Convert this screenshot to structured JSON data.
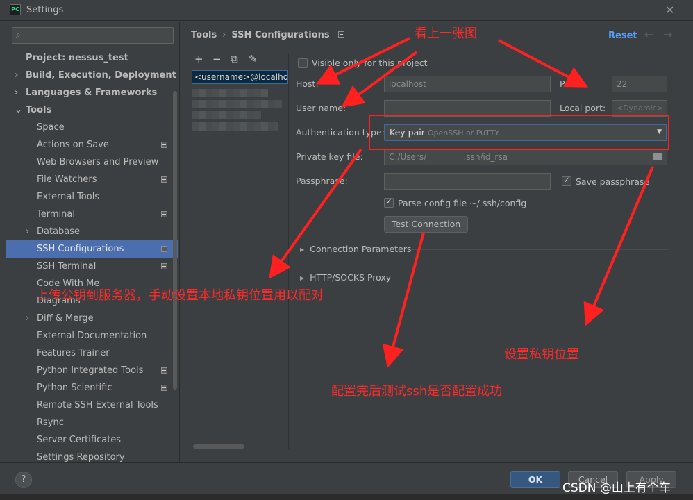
{
  "window": {
    "title": "Settings",
    "app_logo": "PC"
  },
  "sidebar": {
    "items": [
      {
        "label": "Project: nessus_test",
        "bold": true,
        "arrow": "",
        "indent": 0,
        "badge": false
      },
      {
        "label": "Build, Execution, Deployment",
        "bold": true,
        "arrow": "›",
        "indent": 0,
        "badge": false
      },
      {
        "label": "Languages & Frameworks",
        "bold": true,
        "arrow": "›",
        "indent": 0,
        "badge": false
      },
      {
        "label": "Tools",
        "bold": true,
        "arrow": "⌄",
        "indent": 0,
        "badge": false
      },
      {
        "label": "Space",
        "bold": false,
        "arrow": "",
        "indent": 1,
        "badge": false
      },
      {
        "label": "Actions on Save",
        "bold": false,
        "arrow": "",
        "indent": 1,
        "badge": true
      },
      {
        "label": "Web Browsers and Preview",
        "bold": false,
        "arrow": "",
        "indent": 1,
        "badge": false
      },
      {
        "label": "File Watchers",
        "bold": false,
        "arrow": "",
        "indent": 1,
        "badge": true
      },
      {
        "label": "External Tools",
        "bold": false,
        "arrow": "",
        "indent": 1,
        "badge": false
      },
      {
        "label": "Terminal",
        "bold": false,
        "arrow": "",
        "indent": 1,
        "badge": true
      },
      {
        "label": "Database",
        "bold": false,
        "arrow": "›",
        "indent": 1,
        "badge": false
      },
      {
        "label": "SSH Configurations",
        "bold": false,
        "arrow": "",
        "indent": 1,
        "badge": true,
        "selected": true
      },
      {
        "label": "SSH Terminal",
        "bold": false,
        "arrow": "",
        "indent": 1,
        "badge": true
      },
      {
        "label": "Code With Me",
        "bold": false,
        "arrow": "",
        "indent": 1,
        "badge": false
      },
      {
        "label": "Diagrams",
        "bold": false,
        "arrow": "",
        "indent": 1,
        "badge": false
      },
      {
        "label": "Diff & Merge",
        "bold": false,
        "arrow": "›",
        "indent": 1,
        "badge": false
      },
      {
        "label": "External Documentation",
        "bold": false,
        "arrow": "",
        "indent": 1,
        "badge": false
      },
      {
        "label": "Features Trainer",
        "bold": false,
        "arrow": "",
        "indent": 1,
        "badge": false
      },
      {
        "label": "Python Integrated Tools",
        "bold": false,
        "arrow": "",
        "indent": 1,
        "badge": true
      },
      {
        "label": "Python Scientific",
        "bold": false,
        "arrow": "",
        "indent": 1,
        "badge": true
      },
      {
        "label": "Remote SSH External Tools",
        "bold": false,
        "arrow": "",
        "indent": 1,
        "badge": false
      },
      {
        "label": "Rsync",
        "bold": false,
        "arrow": "",
        "indent": 1,
        "badge": false
      },
      {
        "label": "Server Certificates",
        "bold": false,
        "arrow": "",
        "indent": 1,
        "badge": false
      },
      {
        "label": "Settings Repository",
        "bold": false,
        "arrow": "",
        "indent": 1,
        "badge": false
      }
    ]
  },
  "breadcrumb": {
    "parent": "Tools",
    "separator": "›",
    "current": "SSH Configurations"
  },
  "header": {
    "reset_label": "Reset",
    "back_icon": "←",
    "forward_icon": "→"
  },
  "config_list": {
    "selected_item": "<username>@localhost"
  },
  "form": {
    "visible_only_label": "Visible only for this project",
    "host_label": "Host:",
    "host_value": "localhost",
    "port_label": "Port:",
    "port_value": "22",
    "username_label": "User name:",
    "username_value": "",
    "local_port_label": "Local port:",
    "local_port_placeholder": "<Dynamic>",
    "auth_label": "Authentication type:",
    "auth_value": "Key pair",
    "auth_sub": "OpenSSH or PuTTY",
    "private_key_label": "Private key file:",
    "private_key_value": "C:/Users/              .ssh/id_rsa",
    "passphrase_label": "Passphrase:",
    "save_passphrase_label": "Save passphrase",
    "parse_config_label": "Parse config file ~/.ssh/config",
    "test_button": "Test Connection",
    "section_connection": "Connection Parameters",
    "section_proxy": "HTTP/SOCKS Proxy"
  },
  "footer": {
    "help": "?",
    "ok": "OK",
    "cancel": "Cancel",
    "apply": "Apply"
  },
  "annotations": {
    "top": "看上一张图",
    "upload": "上传公钥到服务器，手动设置本地私钥位置用以配对",
    "private_key": "设置私钥位置",
    "test": "配置完后测试ssh是否配置成功",
    "watermark": "CSDN @山上有个车",
    "color": "#ff2a2a"
  }
}
